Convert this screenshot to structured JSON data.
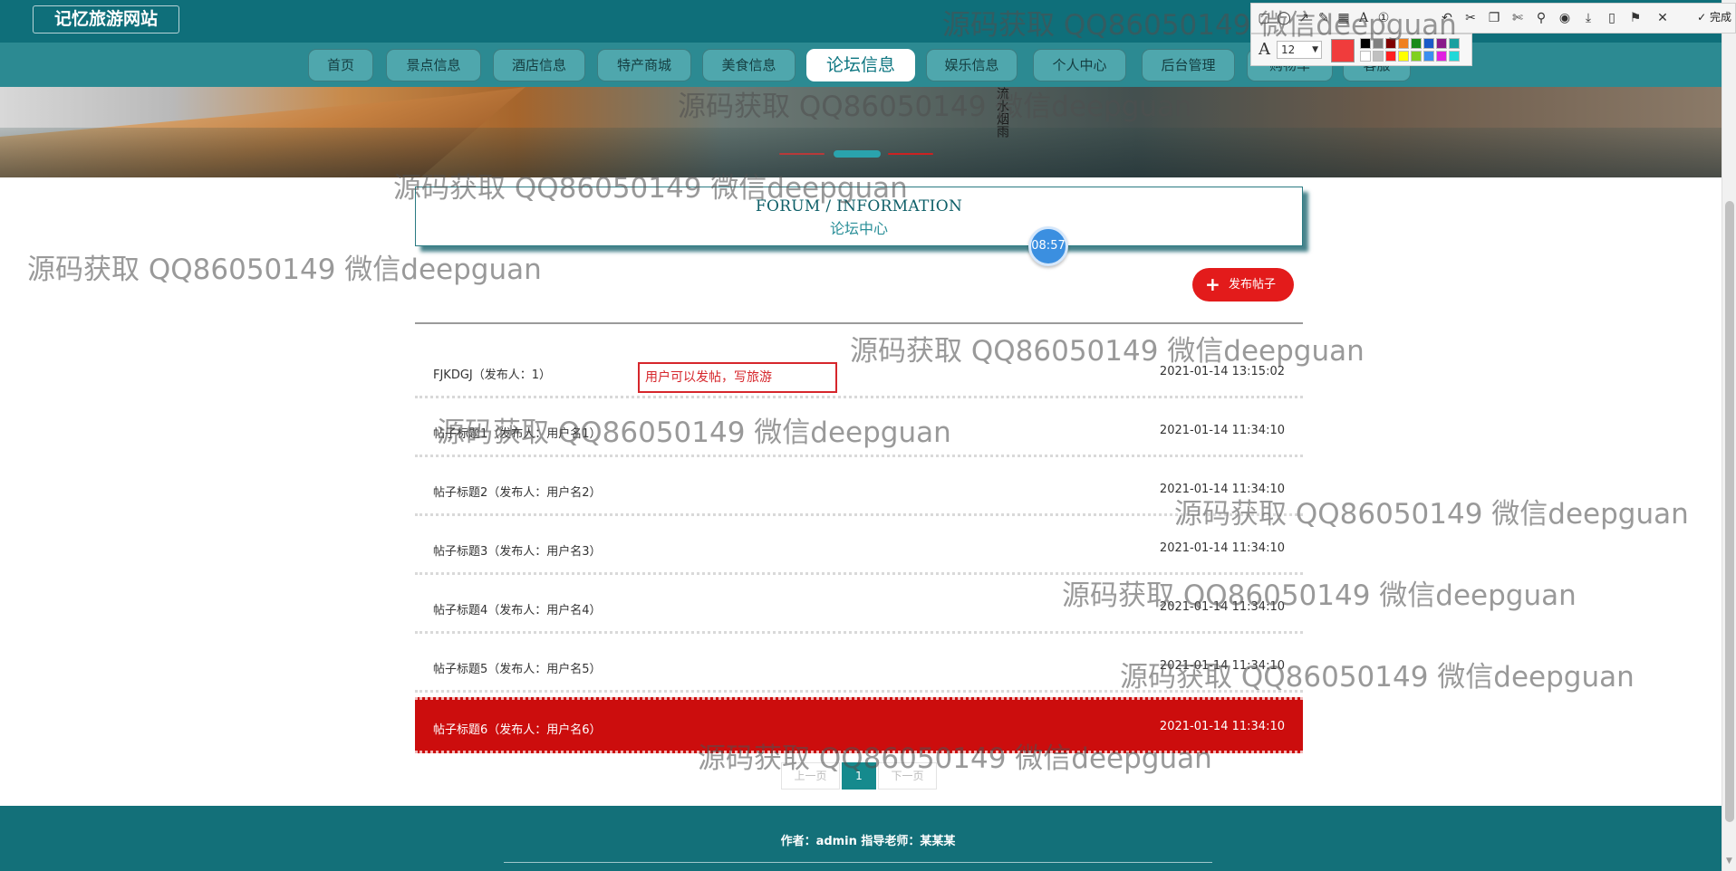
{
  "site": {
    "title": "记忆旅游网站"
  },
  "nav": {
    "items": [
      {
        "label": "首页",
        "id": "home"
      },
      {
        "label": "景点信息",
        "id": "attractions"
      },
      {
        "label": "酒店信息",
        "id": "hotels"
      },
      {
        "label": "特产商城",
        "id": "specialty-mall"
      },
      {
        "label": "美食信息",
        "id": "food"
      },
      {
        "label": "论坛信息",
        "id": "forum",
        "active": true
      },
      {
        "label": "娱乐信息",
        "id": "entertainment"
      },
      {
        "label": "个人中心",
        "id": "profile"
      },
      {
        "label": "后台管理",
        "id": "admin"
      },
      {
        "label": "购物车",
        "id": "cart"
      },
      {
        "label": "客服",
        "id": "service"
      }
    ]
  },
  "banner": {
    "caption": "流水烟雨"
  },
  "section": {
    "title_en": "FORUM / INFORMATION",
    "title_cn": "论坛中心"
  },
  "clock": {
    "time": "08:57"
  },
  "actions": {
    "publish_label": "发布帖子"
  },
  "annotation": {
    "text": "用户可以发帖，写旅游"
  },
  "posts": [
    {
      "title": "FJKDGJ（发布人：1）",
      "time": "2021-01-14 13:15:02"
    },
    {
      "title": "帖子标题1（发布人：用户名1）",
      "time": "2021-01-14 11:34:10"
    },
    {
      "title": "帖子标题2（发布人：用户名2）",
      "time": "2021-01-14 11:34:10"
    },
    {
      "title": "帖子标题3（发布人：用户名3）",
      "time": "2021-01-14 11:34:10"
    },
    {
      "title": "帖子标题4（发布人：用户名4）",
      "time": "2021-01-14 11:34:10"
    },
    {
      "title": "帖子标题5（发布人：用户名5）",
      "time": "2021-01-14 11:34:10"
    },
    {
      "title": "帖子标题6（发布人：用户名6）",
      "time": "2021-01-14 11:34:10",
      "highlighted": true
    }
  ],
  "pagination": {
    "prev": "上一页",
    "current": "1",
    "next": "下一页"
  },
  "footer": {
    "credit": "作者：admin 指导老师：某某某"
  },
  "screenshot_tool": {
    "font_size": "12",
    "done_label": "完成",
    "current_color": "#f03c3c",
    "palette": [
      "#000000",
      "#808080",
      "#800000",
      "#f08020",
      "#1a8a1a",
      "#1a5ac8",
      "#8a1a8a",
      "#1aa0a0",
      "#ffffff",
      "#c0c0c0",
      "#ff2020",
      "#ffff00",
      "#80d020",
      "#3a8ef0",
      "#e020e0",
      "#20d8d8"
    ]
  },
  "watermark": {
    "text": "源码获取 QQ86050149 微信deepguan"
  },
  "colors": {
    "header": "#0f6f7a",
    "accent": "#158a8d",
    "highlight_row": "#cc0d0d",
    "publish": "#e31b1b"
  }
}
